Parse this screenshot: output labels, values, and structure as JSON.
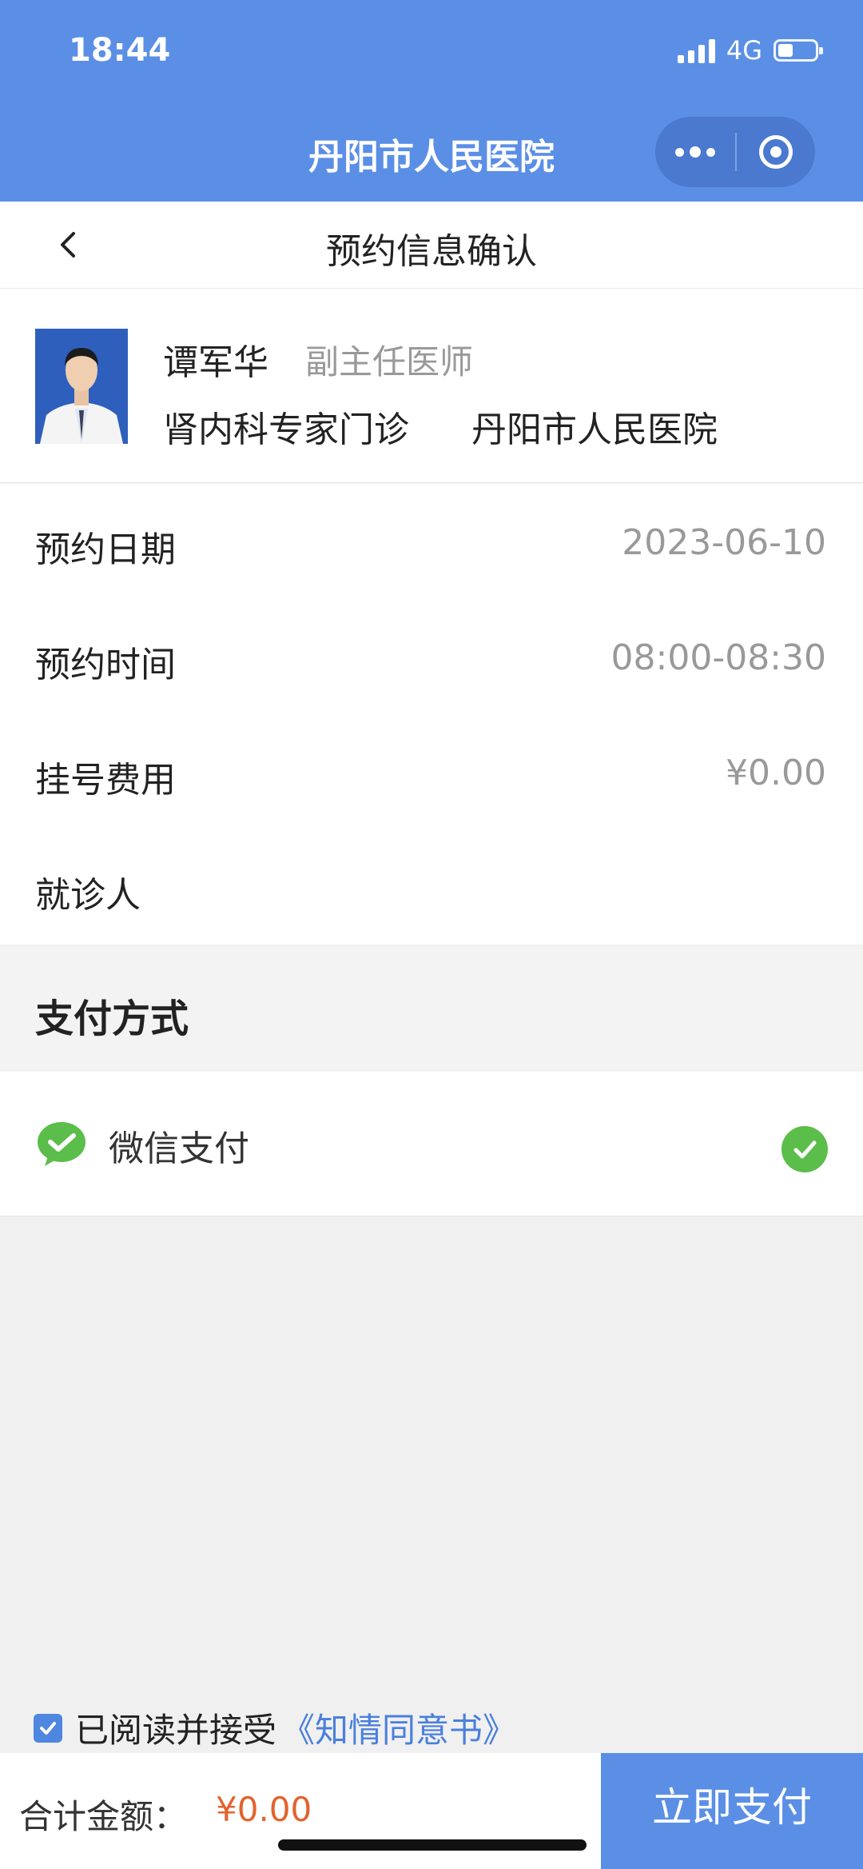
{
  "status_bar": {
    "time": "18:44",
    "network": "4G",
    "battery_level": 0.4
  },
  "nav": {
    "title": "丹阳市人民医院",
    "more_icon": "more-dots-icon",
    "close_icon": "target-circle-icon"
  },
  "header": {
    "title": "预约信息确认",
    "back_icon": "chevron-left-icon"
  },
  "doctor": {
    "name": "谭军华",
    "title": "副主任医师",
    "department": "肾内科专家门诊",
    "hospital": "丹阳市人民医院"
  },
  "info_rows": [
    {
      "label": "预约日期",
      "value": "2023-06-10"
    },
    {
      "label": "预约时间",
      "value": "08:00-08:30"
    },
    {
      "label": "挂号费用",
      "value": "¥0.00"
    },
    {
      "label": "就诊人",
      "value": ""
    }
  ],
  "payment": {
    "section_title": "支付方式",
    "method_label": "微信支付",
    "method_icon": "wechat-pay-icon",
    "selected": true
  },
  "agreement": {
    "checked": true,
    "text": "已阅读并接受",
    "link": "《知情同意书》"
  },
  "footer": {
    "total_label": "合计金额：",
    "total_value": "¥0.00",
    "pay_button": "立即支付"
  },
  "colors": {
    "primary": "#5b8fe6",
    "wechat_green": "#5bbd4a",
    "price_orange": "#e3622e",
    "link_blue": "#4a7fdc"
  }
}
